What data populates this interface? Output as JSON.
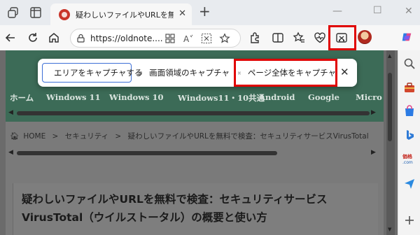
{
  "browser": {
    "tab": {
      "title": "疑わしいファイルやURLを無料で検査"
    },
    "address": {
      "url": "https://oldnote...."
    }
  },
  "capture_toolbar": {
    "area_label": "エリアをキャプチャする",
    "visible_label": "画面領域のキャプチャ",
    "full_page_label": "ページ全体をキャプチャ"
  },
  "site_nav": {
    "items": [
      "ホーム",
      "Windows 11",
      "Windows 10",
      "Windows11・10共通",
      "Android",
      "Google",
      "Micro"
    ]
  },
  "breadcrumb": {
    "home": "HOME",
    "sep1": ">",
    "category": "セキュリティ",
    "sep2": ">",
    "current": "疑わしいファイルやURLを無料で検査：セキュリティサービスVirusTotal"
  },
  "article": {
    "title": "疑わしいファイルやURLを無料で検査：セキュリティサービスVirusTotal（ウイルストータル）の概要と使い方"
  },
  "colors": {
    "highlight": "#e00000",
    "site_band": "#3c6b57",
    "area_button_border": "#3d6fd6"
  },
  "icons": {
    "titlebar": [
      "workspaces-icon",
      "tab-actions-icon"
    ],
    "toolbar": [
      "back-icon",
      "refresh-icon",
      "home-icon",
      "extensions-icon",
      "split-screen-icon",
      "favorites-icon",
      "browser-essentials-icon",
      "screenshot-icon",
      "profile-avatar",
      "more-icon"
    ],
    "sidebar": [
      "copilot-icon",
      "search-icon",
      "tools-icon",
      "shopping-icon",
      "bing-icon",
      "price-comparison-icon",
      "send-icon",
      "add-icon"
    ]
  }
}
